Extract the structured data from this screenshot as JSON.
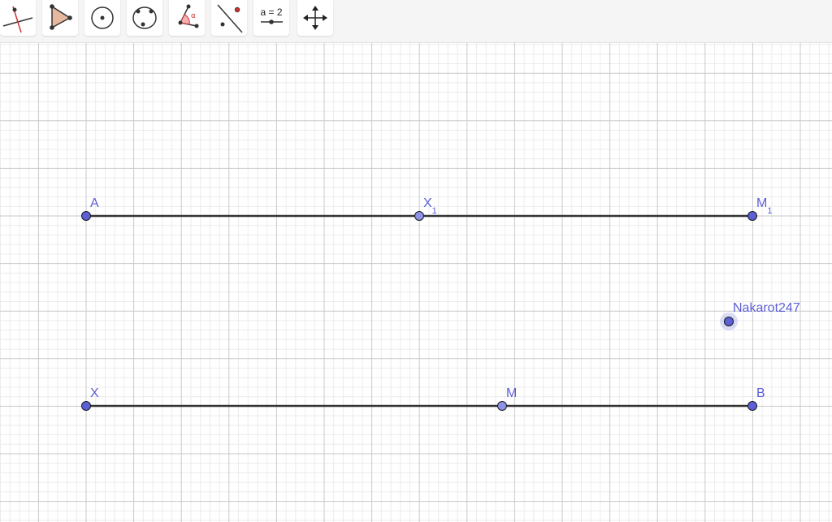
{
  "toolbar": {
    "tools": [
      {
        "id": "perpendicular-line",
        "icon": "perpendicular-line-icon"
      },
      {
        "id": "polygon",
        "icon": "polygon-icon"
      },
      {
        "id": "circle-center-point",
        "icon": "circle-center-point-icon"
      },
      {
        "id": "circle-three-points",
        "icon": "circle-three-points-icon"
      },
      {
        "id": "angle",
        "icon": "angle-icon",
        "glyph": "α"
      },
      {
        "id": "reflect-about-line",
        "icon": "reflect-about-line-icon"
      },
      {
        "id": "slider",
        "icon": "slider-icon",
        "label": "a = 2"
      },
      {
        "id": "move-graphics-view",
        "icon": "move-graphics-view-icon"
      }
    ]
  },
  "colors": {
    "point_fill": "#5c5fd6",
    "point_light_fill": "#8f93e8",
    "segment": "#333333",
    "label": "#5c5fd6",
    "grid_major": "#c9c9c9",
    "grid_minor": "#ececec",
    "angle_accent": "#e05050",
    "polygon_fill": "#e7b8a0"
  },
  "points": {
    "A": {
      "label": "A"
    },
    "X1": {
      "label": "X",
      "sub": "1"
    },
    "M1": {
      "label": "M",
      "sub": "1"
    },
    "Nakarot247": {
      "label": "Nakarot247"
    },
    "X": {
      "label": "X"
    },
    "M": {
      "label": "M"
    },
    "B": {
      "label": "B"
    }
  }
}
